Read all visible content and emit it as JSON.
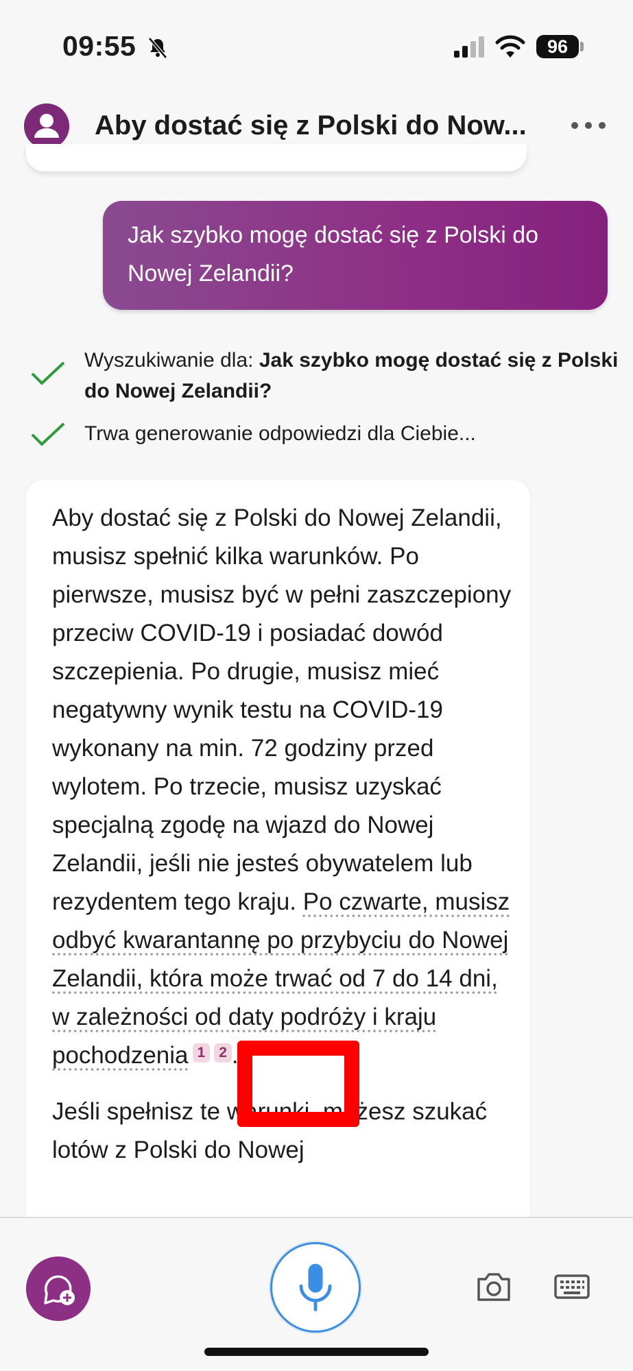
{
  "status_bar": {
    "time": "09:55",
    "battery": "96"
  },
  "header": {
    "title": "Aby dostać się z Polski do Now..."
  },
  "user_message": "Jak szybko mogę dostać się z Polski do Nowej Zelandii?",
  "progress": {
    "search_prefix": "Wyszukiwanie dla: ",
    "search_query": "Jak szybko mogę dostać się z Polski do Nowej Zelandii?",
    "generating": "Trwa generowanie odpowiedzi dla Ciebie..."
  },
  "answer": {
    "part1": "Aby dostać się z Polski do Nowej Zelandii, musisz spełnić kilka warunków. Po pierwsze, musisz być w pełni zaszczepiony przeciw COVID-19 i posiadać dowód szczepienia. Po drugie, musisz mieć negatywny wynik testu na COVID-19 wykonany na min. 72 godziny przed wylotem. Po trzecie, musisz uzyskać specjalną zgodę na wjazd do Nowej Zelandii, jeśli nie jesteś obywatelem lub rezydentem tego kraju. ",
    "cited_sentence": "Po czwarte, musisz odbyć kwarantannę po przybyciu do Nowej Zelandii, która może trwać od 7 do 14 dni, w zależności od daty podróży i kraju pochodzenia",
    "citation_1": "1",
    "citation_2": "2",
    "end_punct": ".",
    "part2": "Jeśli spełnisz te warunki, możesz szukać lotów z Polski do Nowej"
  },
  "icons": {
    "bell": "bell-slash-icon",
    "signal": "cellular-signal-icon",
    "wifi": "wifi-icon",
    "avatar": "user-avatar-icon",
    "more": "more-dots-icon",
    "check": "checkmark-icon",
    "new_chat": "new-chat-icon",
    "mic": "microphone-icon",
    "camera": "camera-icon",
    "keyboard": "keyboard-icon"
  },
  "colors": {
    "brand": "#8e2f86",
    "mic_accent": "#3a8ee6",
    "check": "#2e9b3a",
    "highlight": "#ff0000"
  }
}
